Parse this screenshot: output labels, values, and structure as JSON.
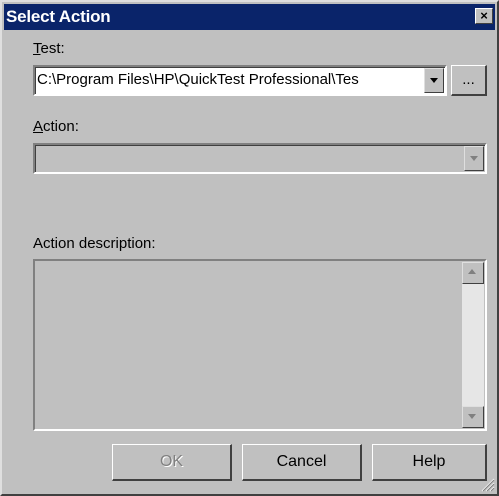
{
  "window": {
    "title": "Select Action",
    "close_glyph": "×"
  },
  "test": {
    "label_prefix": "T",
    "label_rest": "est:",
    "value": "C:\\Program Files\\HP\\QuickTest Professional\\Tes",
    "browse_label": "..."
  },
  "action": {
    "label_prefix": "A",
    "label_rest": "ction:",
    "value": ""
  },
  "description": {
    "label": "Action description:",
    "value": ""
  },
  "buttons": {
    "ok": "OK",
    "cancel": "Cancel",
    "help": "Help"
  },
  "icons": {
    "dropdown": "chevron-down-icon",
    "scroll_up": "arrow-up-icon",
    "scroll_down": "arrow-down-icon",
    "resize": "resize-grip-icon",
    "close": "close-icon"
  }
}
